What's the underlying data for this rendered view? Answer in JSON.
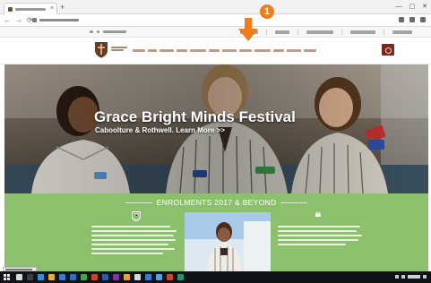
{
  "browser": {
    "tab_close_glyph": "×",
    "new_tab_glyph": "+",
    "window_controls": [
      "—",
      "▢",
      "✕"
    ],
    "nav_glyphs": [
      "←",
      "→",
      "⟳"
    ]
  },
  "hero": {
    "title": "Grace Bright Minds Festival",
    "subtitle": "Caboolture & Rothwell. Learn More >>"
  },
  "enrolments": {
    "title": "ENROLMENTS 2017 & BEYOND",
    "quote_glyph": "❝",
    "left_icon": "shield-icon",
    "right_icon": "quote-icon"
  },
  "annotation": {
    "badge_label": "1",
    "badge_color": "#f07d1a"
  },
  "colors": {
    "brand": "#7a2a1d",
    "enrol_band": "#8cc06d",
    "taskbar": "#101318"
  }
}
